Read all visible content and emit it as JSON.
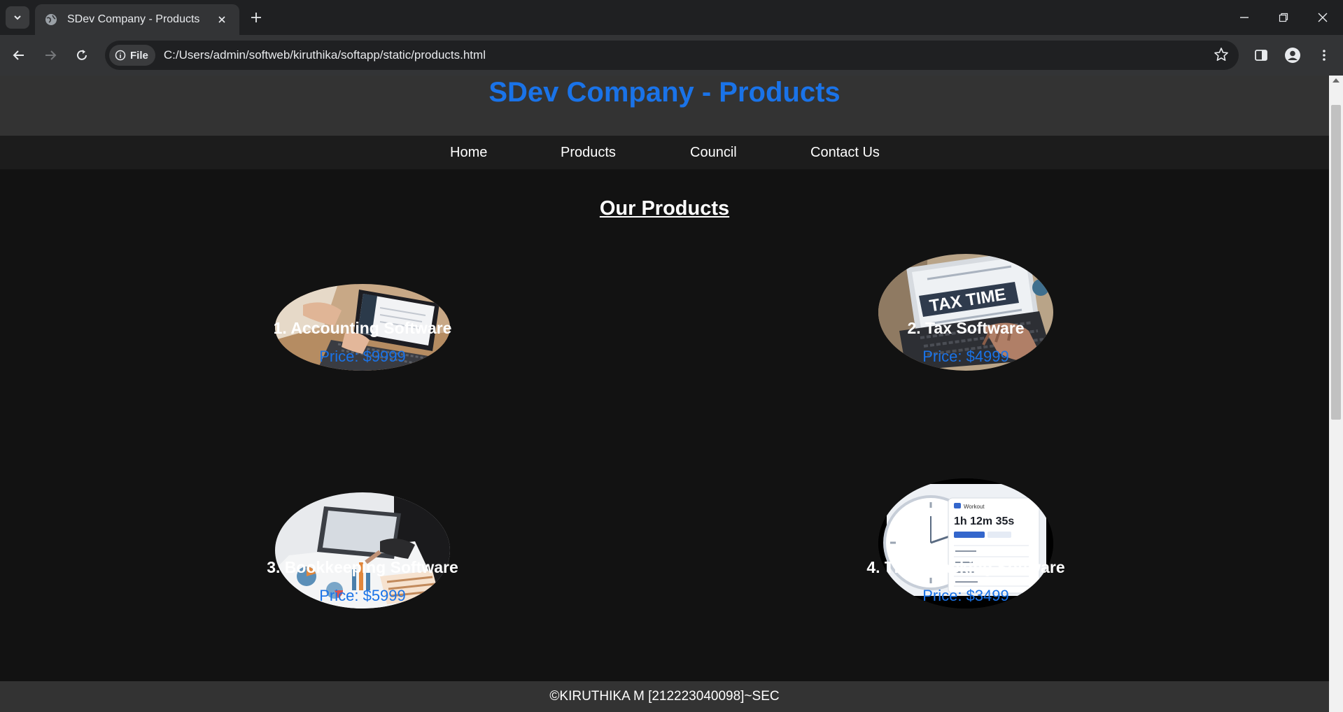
{
  "browser": {
    "tab_title": "SDev Company - Products",
    "omnibox_chip": "File",
    "url": "C:/Users/admin/softweb/kiruthika/softapp/static/products.html"
  },
  "site": {
    "title": "SDev Company - Products",
    "nav": [
      "Home",
      "Products",
      "Council",
      "Contact Us"
    ],
    "section_title": "Our Products",
    "products": [
      {
        "name": "1. Accounting Software",
        "price": "Price: $9999"
      },
      {
        "name": "2. Tax Software",
        "price": "Price: $4999"
      },
      {
        "name": "3. Bookkeeping Software",
        "price": "Price: $5999"
      },
      {
        "name": "4. Time Tracking Software",
        "price": "Price: $3499"
      }
    ],
    "image_labels": {
      "tax": "TAX TIME",
      "timer": "1h 12m 35s"
    },
    "footer": "©KIRUTHIKA M [212223040098]~SEC"
  },
  "colors": {
    "accent": "#1a73e8",
    "page_bg": "#121212",
    "header_bg": "#333333",
    "nav_bg": "#1c1c1c"
  }
}
